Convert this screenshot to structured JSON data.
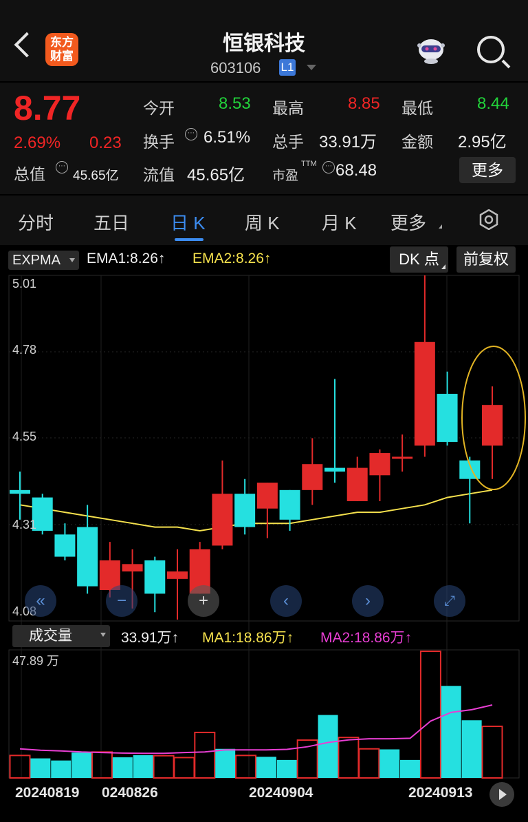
{
  "header": {
    "logo_line1": "东方",
    "logo_line2": "财富",
    "stock_name": "恒银科技",
    "stock_code": "603106",
    "level_badge": "L1"
  },
  "quote": {
    "price": "8.77",
    "change_pct": "2.69%",
    "change": "0.23",
    "total_value_label": "总值",
    "total_value": "45.65亿",
    "open_label": "今开",
    "open": "8.53",
    "high_label": "最高",
    "high": "8.85",
    "low_label": "最低",
    "low": "8.44",
    "turnover_label": "换手",
    "turnover": "6.51%",
    "volume_label": "总手",
    "volume": "33.91万",
    "amount_label": "金额",
    "amount": "2.95亿",
    "float_label": "流值",
    "float_value": "45.65亿",
    "pe_label": "市盈",
    "pe_suffix": "TTM",
    "pe": "68.48",
    "more_label": "更多"
  },
  "tabs": [
    {
      "label": "分时",
      "active": false
    },
    {
      "label": "五日",
      "active": false
    },
    {
      "label": "日 K",
      "active": true
    },
    {
      "label": "周 K",
      "active": false
    },
    {
      "label": "月 K",
      "active": false
    },
    {
      "label": "更多",
      "active": false
    }
  ],
  "indicator": {
    "name": "EXPMA",
    "ema1": "EMA1:8.26",
    "ema2": "EMA2:8.26",
    "arrow": "↑",
    "dk_label": "DK 点",
    "adjust_label": "前复权"
  },
  "volume": {
    "name": "成交量",
    "current": "33.91万",
    "ma1": "MA1:18.86万",
    "ma2": "MA2:18.86万",
    "max_label": "47.89 万"
  },
  "price_axis": [
    "5.01",
    "4.78",
    "4.55",
    "4.31",
    "4.08"
  ],
  "dates": [
    "20240819",
    "0240826",
    "20240904",
    "20240913"
  ],
  "colors": {
    "up": "#e32a2a",
    "down": "#25e0e0",
    "ema": "#f5e14d",
    "vol_ma": "#e83ed3",
    "accent": "#3c8cf0"
  },
  "chart_data": {
    "type": "candlestick",
    "ylim": [
      4.08,
      5.01
    ],
    "candles": [
      {
        "o": 4.43,
        "c": 4.42,
        "h": 4.48,
        "l": 4.35
      },
      {
        "o": 4.41,
        "c": 4.32,
        "h": 4.42,
        "l": 4.31
      },
      {
        "o": 4.31,
        "c": 4.25,
        "h": 4.34,
        "l": 4.24
      },
      {
        "o": 4.33,
        "c": 4.17,
        "h": 4.39,
        "l": 4.15
      },
      {
        "o": 4.16,
        "c": 4.24,
        "h": 4.29,
        "l": 4.14
      },
      {
        "o": 4.21,
        "c": 4.23,
        "h": 4.27,
        "l": 4.11
      },
      {
        "o": 4.24,
        "c": 4.15,
        "h": 4.25,
        "l": 4.1
      },
      {
        "o": 4.19,
        "c": 4.21,
        "h": 4.27,
        "l": 4.08
      },
      {
        "o": 4.15,
        "c": 4.27,
        "h": 4.29,
        "l": 4.15
      },
      {
        "o": 4.28,
        "c": 4.42,
        "h": 4.51,
        "l": 4.27
      },
      {
        "o": 4.42,
        "c": 4.33,
        "h": 4.46,
        "l": 4.31
      },
      {
        "o": 4.38,
        "c": 4.45,
        "h": 4.45,
        "l": 4.3
      },
      {
        "o": 4.43,
        "c": 4.35,
        "h": 4.43,
        "l": 4.32
      },
      {
        "o": 4.43,
        "c": 4.5,
        "h": 4.57,
        "l": 4.39
      },
      {
        "o": 4.49,
        "c": 4.48,
        "h": 4.73,
        "l": 4.45
      },
      {
        "o": 4.4,
        "c": 4.49,
        "h": 4.52,
        "l": 4.4
      },
      {
        "o": 4.47,
        "c": 4.53,
        "h": 4.54,
        "l": 4.4
      },
      {
        "o": 4.52,
        "c": 4.52,
        "h": 4.58,
        "l": 4.48
      },
      {
        "o": 4.55,
        "c": 4.83,
        "h": 5.01,
        "l": 4.52
      },
      {
        "o": 4.69,
        "c": 4.56,
        "h": 4.75,
        "l": 4.55
      },
      {
        "o": 4.51,
        "c": 4.46,
        "h": 4.52,
        "l": 4.34
      },
      {
        "o": 4.55,
        "c": 4.66,
        "h": 4.71,
        "l": 4.46
      }
    ],
    "ema": [
      4.39,
      4.38,
      4.37,
      4.36,
      4.35,
      4.34,
      4.33,
      4.33,
      4.32,
      4.33,
      4.34,
      4.34,
      4.34,
      4.35,
      4.36,
      4.37,
      4.37,
      4.38,
      4.39,
      4.41,
      4.42,
      4.43
    ],
    "volumes": [
      8.5,
      7.4,
      6.6,
      9.6,
      9.8,
      7.8,
      8.6,
      8.4,
      7.7,
      17.2,
      11.0,
      8.5,
      8.0,
      6.8,
      14.3,
      23.8,
      15.3,
      11.0,
      10.8,
      6.8,
      47.89,
      34.8,
      21.8,
      19.5
    ],
    "vol_ma": [
      11.0,
      10.5,
      10.2,
      9.8,
      9.6,
      9.4,
      9.3,
      9.3,
      9.6,
      9.8,
      10.6,
      10.6,
      10.6,
      10.8,
      11.8,
      13.4,
      14.4,
      14.8,
      14.8,
      15.0,
      21.5,
      24.8,
      25.8,
      27.6
    ],
    "vol_up": [
      true,
      false,
      false,
      false,
      true,
      false,
      false,
      true,
      true,
      true,
      false,
      true,
      false,
      false,
      true,
      false,
      true,
      true,
      false,
      false,
      true,
      false,
      false,
      true
    ],
    "vol_max": 47.89
  }
}
